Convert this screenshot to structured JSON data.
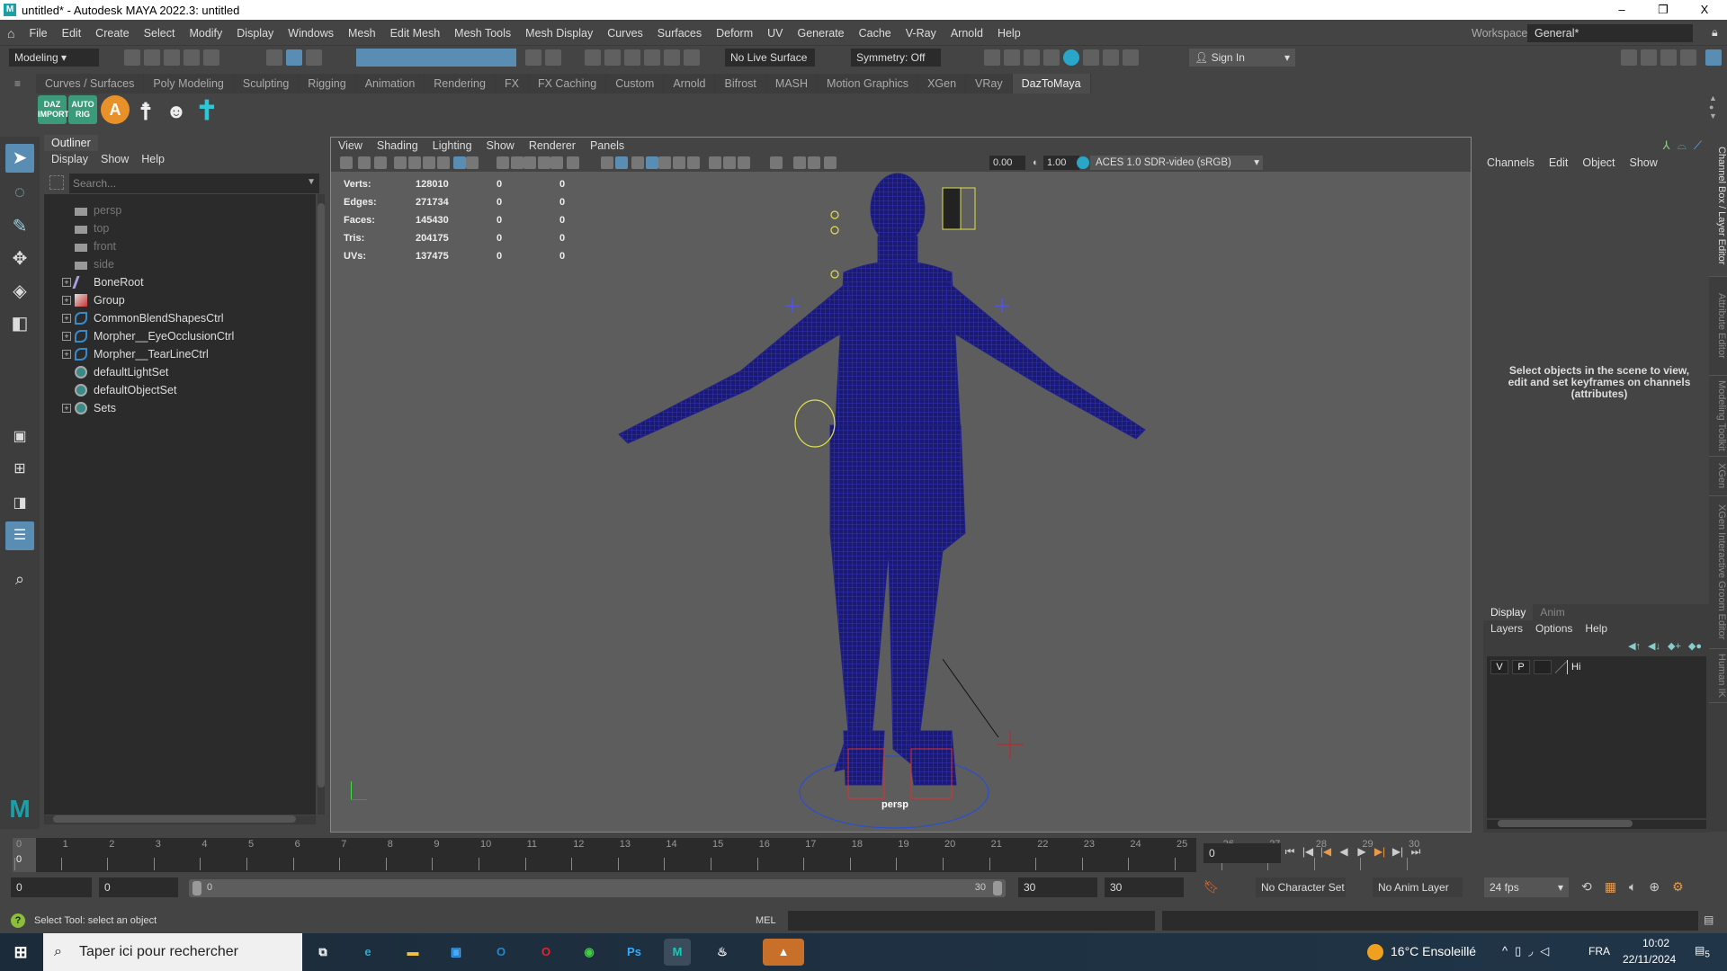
{
  "window": {
    "title": "untitled* - Autodesk MAYA 2022.3: untitled",
    "logo": "M",
    "minimize": "–",
    "restore": "❐",
    "close": "X"
  },
  "menu": [
    "File",
    "Edit",
    "Create",
    "Select",
    "Modify",
    "Display",
    "Windows",
    "Mesh",
    "Edit Mesh",
    "Mesh Tools",
    "Mesh Display",
    "Curves",
    "Surfaces",
    "Deform",
    "UV",
    "Generate",
    "Cache",
    "V-Ray",
    "Arnold",
    "Help"
  ],
  "workspace": {
    "label": "Workspace:",
    "value": "General*"
  },
  "status": {
    "mode": "Modeling",
    "live_surface": "No Live Surface",
    "symmetry": "Symmetry: Off",
    "sign_in": "Sign In"
  },
  "shelf_tabs": [
    "Curves / Surfaces",
    "Poly Modeling",
    "Sculpting",
    "Rigging",
    "Animation",
    "Rendering",
    "FX",
    "FX Caching",
    "Custom",
    "Arnold",
    "Bifrost",
    "MASH",
    "Motion Graphics",
    "XGen",
    "VRay",
    "DazToMaya"
  ],
  "shelf_icons": [
    {
      "label": "DAZ IMPORT",
      "color": "#3a9a7a"
    },
    {
      "label": "AUTO RIG",
      "color": "#3a9a7a"
    },
    {
      "label": "A",
      "color": "#e8902a"
    }
  ],
  "outliner": {
    "title": "Outliner",
    "menu": [
      "Display",
      "Show",
      "Help"
    ],
    "search_placeholder": "Search...",
    "items": [
      {
        "label": "persp",
        "type": "camera",
        "dim": true,
        "expand": false
      },
      {
        "label": "top",
        "type": "camera",
        "dim": true,
        "expand": false
      },
      {
        "label": "front",
        "type": "camera",
        "dim": true,
        "expand": false
      },
      {
        "label": "side",
        "type": "camera",
        "dim": true,
        "expand": false
      },
      {
        "label": "BoneRoot",
        "type": "joint",
        "dim": false,
        "expand": true
      },
      {
        "label": "Group",
        "type": "group",
        "dim": false,
        "expand": true
      },
      {
        "label": "CommonBlendShapesCtrl",
        "type": "curve",
        "dim": false,
        "expand": true
      },
      {
        "label": "Morpher__EyeOcclusionCtrl",
        "type": "curve",
        "dim": false,
        "expand": true
      },
      {
        "label": "Morpher__TearLineCtrl",
        "type": "curve",
        "dim": false,
        "expand": true
      },
      {
        "label": "defaultLightSet",
        "type": "set",
        "dim": false,
        "expand": false
      },
      {
        "label": "defaultObjectSet",
        "type": "set",
        "dim": false,
        "expand": false
      },
      {
        "label": "Sets",
        "type": "set",
        "dim": false,
        "expand": true
      }
    ]
  },
  "viewport": {
    "menu": [
      "View",
      "Shading",
      "Lighting",
      "Show",
      "Renderer",
      "Panels"
    ],
    "exposure": "0.00",
    "gamma": "1.00",
    "color_space": "ACES 1.0 SDR-video (sRGB)",
    "camera_label": "persp",
    "stats": [
      {
        "k": "Verts:",
        "v": "128010",
        "a": "0",
        "b": "0"
      },
      {
        "k": "Edges:",
        "v": "271734",
        "a": "0",
        "b": "0"
      },
      {
        "k": "Faces:",
        "v": "145430",
        "a": "0",
        "b": "0"
      },
      {
        "k": "Tris:",
        "v": "204175",
        "a": "0",
        "b": "0"
      },
      {
        "k": "UVs:",
        "v": "137475",
        "a": "0",
        "b": "0"
      }
    ]
  },
  "channel_box": {
    "menu": [
      "Channels",
      "Edit",
      "Object",
      "Show"
    ],
    "message": "Select objects in the scene to view, edit and set keyframes on channels (attributes)"
  },
  "layer_editor": {
    "tabs": [
      "Display",
      "Anim"
    ],
    "menu": [
      "Layers",
      "Options",
      "Help"
    ],
    "layer_v": "V",
    "layer_p": "P",
    "layer_name": "Hi"
  },
  "side_tabs": [
    "Channel Box / Layer Editor",
    "Attribute Editor",
    "Modeling Toolkit",
    "XGen",
    "XGen Interactive Groom Editor",
    "Human IK"
  ],
  "timeline": {
    "ticks": [
      "0",
      "1",
      "2",
      "3",
      "4",
      "5",
      "6",
      "7",
      "8",
      "9",
      "10",
      "11",
      "12",
      "13",
      "14",
      "15",
      "16",
      "17",
      "18",
      "19",
      "20",
      "21",
      "22",
      "23",
      "24",
      "25",
      "26",
      "27",
      "28",
      "29",
      "30"
    ],
    "current": "0",
    "current_field": "0"
  },
  "range": {
    "start": "0",
    "anim_start": "0",
    "slider_start": "0",
    "slider_end": "30",
    "end": "30",
    "anim_end": "30",
    "character_set": "No Character Set",
    "anim_layer": "No Anim Layer",
    "fps": "24 fps"
  },
  "command": {
    "help": "Select Tool: select an object",
    "lang": "MEL"
  },
  "taskbar": {
    "search": "Taper ici pour rechercher",
    "weather": "16°C  Ensoleillé",
    "lang": "FRA",
    "time": "10:02",
    "date": "22/11/2024",
    "notifications": "5"
  }
}
